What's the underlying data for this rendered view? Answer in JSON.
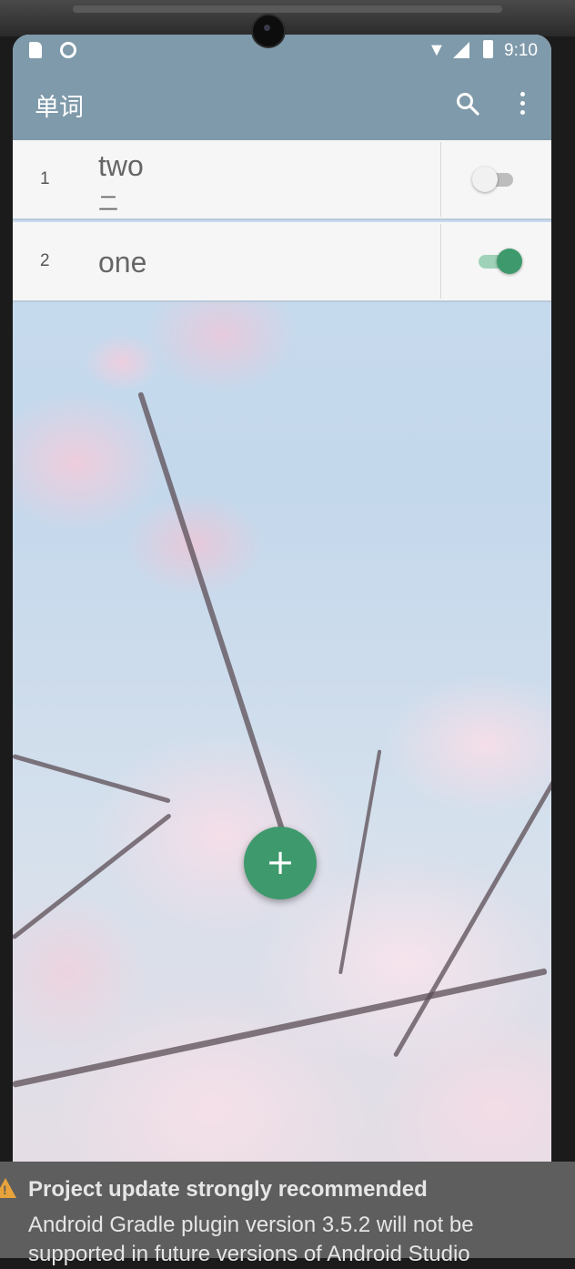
{
  "status_bar": {
    "time": "9:10"
  },
  "app_bar": {
    "title": "单词"
  },
  "words": [
    {
      "index": "1",
      "word": "two",
      "meaning": "二",
      "show_meaning": false
    },
    {
      "index": "2",
      "word": "one",
      "meaning": "",
      "show_meaning": true
    }
  ],
  "fab": {
    "symbol": "+"
  },
  "notification": {
    "title": "Project update strongly recommended",
    "body": "Android Gradle plugin version 3.5.2 will not be supported in future versions of Android Studio"
  },
  "colors": {
    "app_bar": "#7f9aaa",
    "accent": "#3e9a6c",
    "notice_bg": "#5e5e5e",
    "warning": "#e8a33a"
  },
  "icons": {
    "search": "search-icon",
    "more": "more-vert-icon",
    "warning": "warning-icon"
  }
}
